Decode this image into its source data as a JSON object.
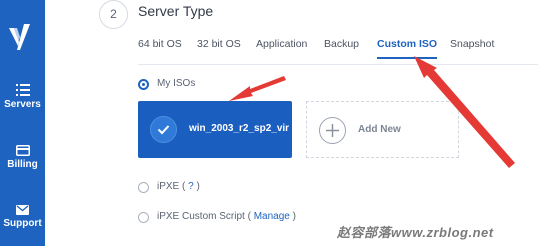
{
  "sidebar": {
    "items": [
      {
        "label": "Servers",
        "icon": "server-list-icon"
      },
      {
        "label": "Billing",
        "icon": "credit-card-icon"
      },
      {
        "label": "Support",
        "icon": "mail-icon"
      }
    ]
  },
  "section": {
    "step_number": "2",
    "title": "Server Type"
  },
  "tabs": [
    {
      "label": "64 bit OS",
      "active": false
    },
    {
      "label": "32 bit OS",
      "active": false
    },
    {
      "label": "Application",
      "active": false
    },
    {
      "label": "Backup",
      "active": false
    },
    {
      "label": "Custom ISO",
      "active": true
    },
    {
      "label": "Snapshot",
      "active": false
    }
  ],
  "options": {
    "my_isos": "My ISOs",
    "ipxe": "iPXE",
    "ipxe_help_open": "( ",
    "ipxe_help_link": "?",
    "ipxe_help_close": " )",
    "ipxe_custom": "iPXE Custom Script",
    "ipxe_custom_open": "( ",
    "ipxe_custom_link": "Manage",
    "ipxe_custom_close": " )"
  },
  "iso_card": {
    "name": "win_2003_r2_sp2_vir..."
  },
  "add_card": {
    "label": "Add New"
  },
  "watermark": "赵容部落www.zrblog.net",
  "colors": {
    "brand": "#1e63c0",
    "annotation_arrow": "#e53935"
  }
}
